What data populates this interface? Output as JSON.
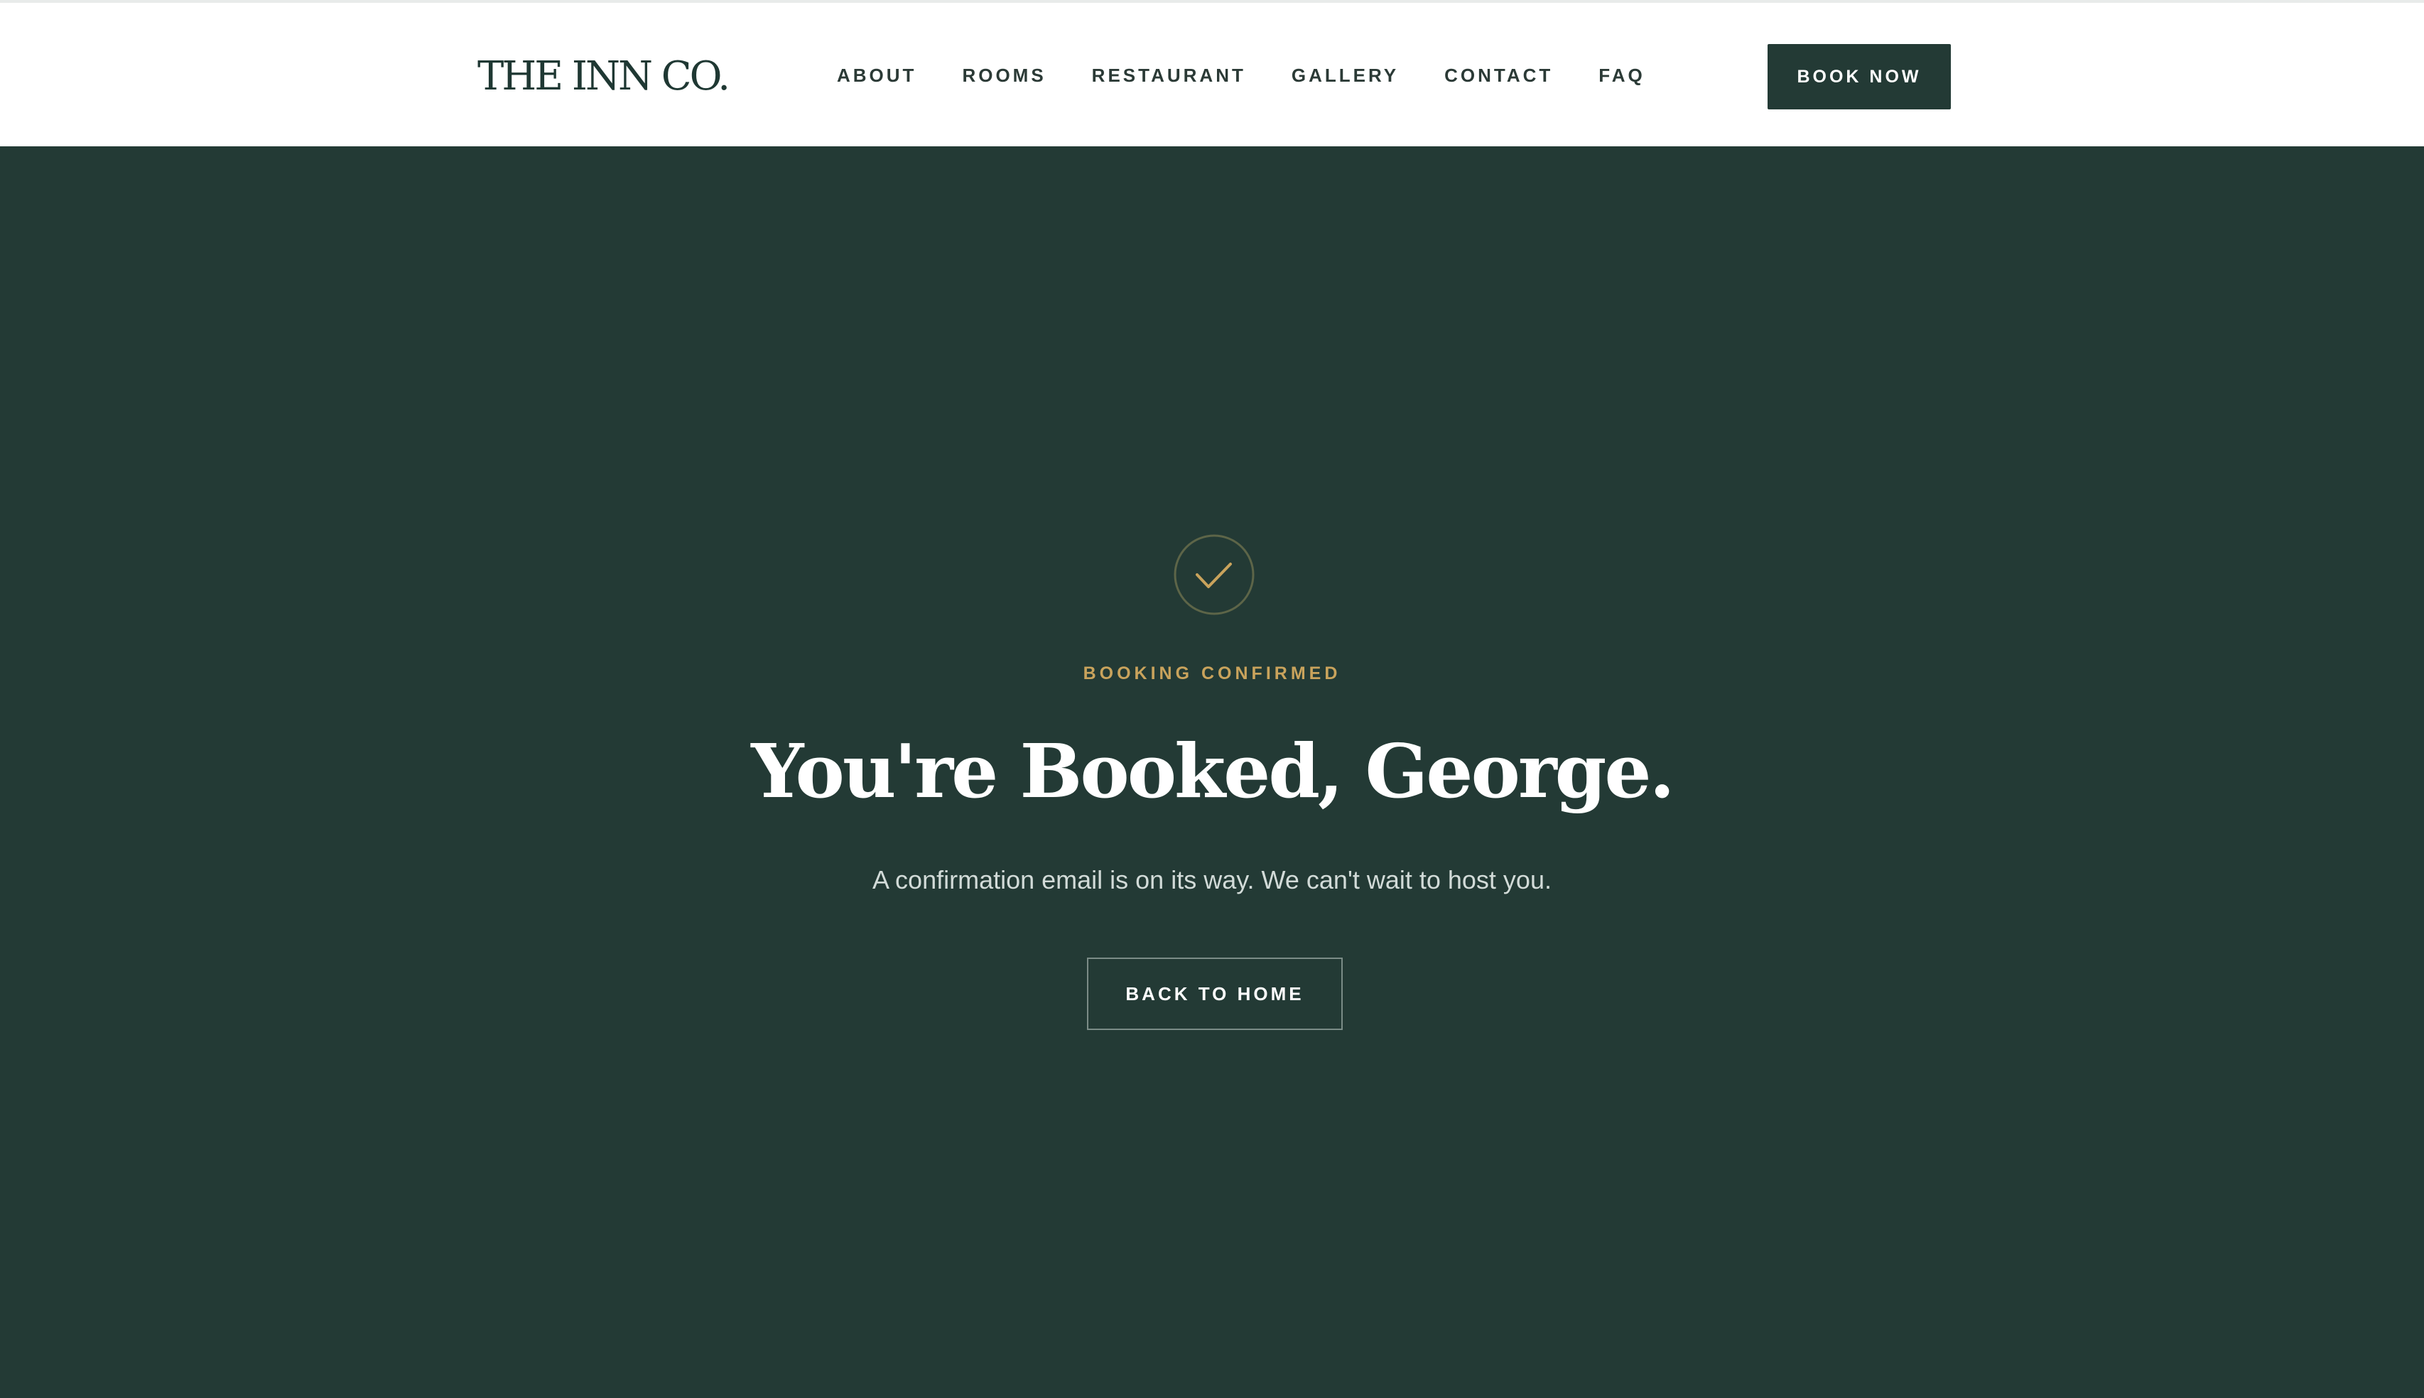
{
  "header": {
    "logo": "THE INN CO.",
    "nav": [
      "ABOUT",
      "ROOMS",
      "RESTAURANT",
      "GALLERY",
      "CONTACT",
      "FAQ"
    ],
    "book_now": "BOOK NOW"
  },
  "hero": {
    "icon": "check-icon",
    "eyebrow": "BOOKING CONFIRMED",
    "headline": "You're Booked, George.",
    "subtext": "A confirmation email is on its way. We can't wait to host you.",
    "back_home": "BACK TO HOME"
  },
  "colors": {
    "brand_green": "#233a35",
    "accent_gold": "#c9a35c",
    "white": "#ffffff"
  }
}
